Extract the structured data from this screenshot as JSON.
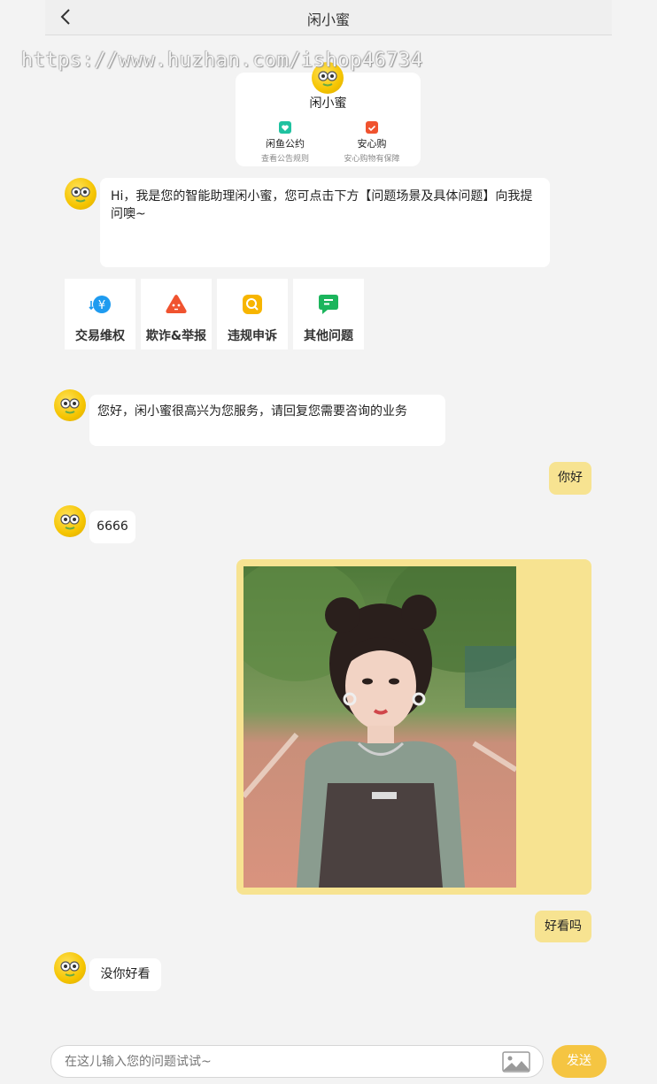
{
  "header": {
    "title": "闲小蜜",
    "back_icon": "chevron-left-icon"
  },
  "watermark": "https://www.huzhan.com/ishop46734",
  "profile_card": {
    "name": "闲小蜜",
    "items": [
      {
        "title": "闲鱼公约",
        "subtitle": "查看公告规则",
        "icon": "heart-badge-icon",
        "color": "#1fc2a0"
      },
      {
        "title": "安心购",
        "subtitle": "安心购物有保障",
        "icon": "shield-check-icon",
        "color": "#f0532f"
      }
    ]
  },
  "messages": {
    "intro": "Hi，我是您的智能助理闲小蜜，您可点击下方【问题场景及具体问题】向我提问噢~",
    "greeting": "您好，闲小蜜很高兴为您服务，请回复您需要咨询的业务",
    "user_hello": "你好",
    "bot_6666": "6666",
    "user_pretty": "好看吗",
    "bot_reply": "没你好看"
  },
  "quick_tiles": [
    {
      "label": "交易维权",
      "icon": "yen-exchange-icon",
      "color": "#1e9bf0"
    },
    {
      "label": "欺诈&举报",
      "icon": "warning-triangle-icon",
      "color": "#f0532f"
    },
    {
      "label": "违规申诉",
      "icon": "search-doc-icon",
      "color": "#f7b500"
    },
    {
      "label": "其他问题",
      "icon": "chat-note-icon",
      "color": "#1bb55c"
    }
  ],
  "image_message": {
    "description_icon": "photo-icon"
  },
  "input": {
    "placeholder": "在这儿输入您的问题试试~",
    "value": "",
    "image_icon": "image-upload-icon"
  },
  "send_label": "发送",
  "colors": {
    "accent": "#f5c542",
    "user_bubble": "#f7e391",
    "background": "#f3f3f3"
  }
}
